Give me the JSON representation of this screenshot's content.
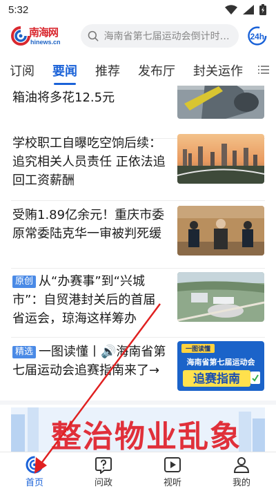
{
  "status_bar": {
    "time": "5:32"
  },
  "header": {
    "logo_text": "南海网",
    "logo_sub": "hinews.cn",
    "search_placeholder": "海南省第七届运动会倒计时1...",
    "badge_label": "24h"
  },
  "tabs": [
    {
      "label": "订阅",
      "active": false
    },
    {
      "label": "要闻",
      "active": true
    },
    {
      "label": "推荐",
      "active": false
    },
    {
      "label": "发布厅",
      "active": false
    },
    {
      "label": "封关运作",
      "active": false
    }
  ],
  "news": [
    {
      "title": "箱油将多花12.5元",
      "tag": ""
    },
    {
      "title": "学校职工自曝吃空饷后续：追究相关人员责任 正依法追回工资薪酬",
      "tag": ""
    },
    {
      "title": "受贿1.89亿余元！重庆市委原常委陆克华一审被判死缓",
      "tag": ""
    },
    {
      "title": "从“办赛事”到“兴城市”：自贸港封关后的首届省运会，琼海这样筹办",
      "tag": "原创"
    },
    {
      "title": "一图读懂丨🔊海南省第七届运动会追赛指南来了→",
      "tag": "精选"
    }
  ],
  "thumb_texts": {
    "poster_top": "一图读懂",
    "poster_mid": "海南省第七届运动会",
    "poster_big": "追赛指南"
  },
  "banner": {
    "text": "整治物业乱象"
  },
  "bottom_nav": [
    {
      "label": "首页",
      "icon": "home-swirl-icon",
      "active": true
    },
    {
      "label": "问政",
      "icon": "question-bubble-icon",
      "active": false
    },
    {
      "label": "视听",
      "icon": "play-icon",
      "active": false
    },
    {
      "label": "我的",
      "icon": "profile-icon",
      "active": false
    }
  ],
  "colors": {
    "accent": "#1a62d8",
    "brand_red": "#d9282f",
    "annotation_red": "#e02020"
  }
}
